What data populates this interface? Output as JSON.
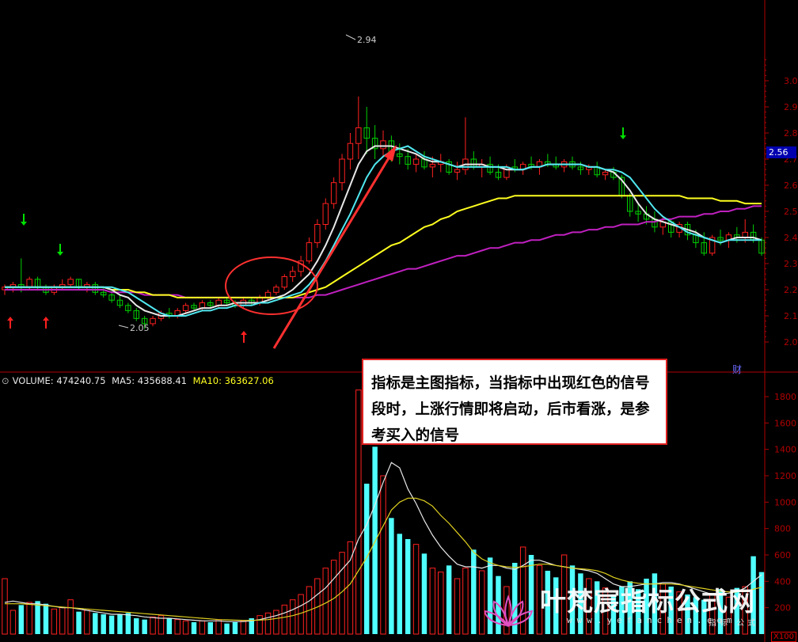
{
  "chart_data": [
    {
      "type": "candlestick",
      "title": "",
      "price_axis": {
        "ylim": [
          1.93,
          3.05
        ],
        "ticks": [
          2.0,
          2.1,
          2.2,
          2.3,
          2.4,
          2.5,
          2.6,
          2.7,
          2.8,
          2.9,
          3.0
        ]
      },
      "current_price": "2.56",
      "high_label": "2.94",
      "low_label": "2.05",
      "candles": [
        [
          2.2,
          2.22,
          2.18,
          2.21
        ],
        [
          2.21,
          2.23,
          2.19,
          2.22
        ],
        [
          2.22,
          2.32,
          2.19,
          2.21
        ],
        [
          2.21,
          2.25,
          2.2,
          2.24
        ],
        [
          2.24,
          2.25,
          2.2,
          2.21
        ],
        [
          2.21,
          2.22,
          2.18,
          2.19
        ],
        [
          2.19,
          2.22,
          2.18,
          2.21
        ],
        [
          2.21,
          2.24,
          2.2,
          2.22
        ],
        [
          2.22,
          2.25,
          2.21,
          2.24
        ],
        [
          2.24,
          2.24,
          2.2,
          2.21
        ],
        [
          2.21,
          2.23,
          2.19,
          2.22
        ],
        [
          2.22,
          2.23,
          2.18,
          2.19
        ],
        [
          2.19,
          2.21,
          2.17,
          2.18
        ],
        [
          2.18,
          2.2,
          2.15,
          2.16
        ],
        [
          2.16,
          2.18,
          2.13,
          2.14
        ],
        [
          2.14,
          2.15,
          2.11,
          2.12
        ],
        [
          2.12,
          2.13,
          2.08,
          2.09
        ],
        [
          2.09,
          2.1,
          2.05,
          2.07
        ],
        [
          2.07,
          2.1,
          2.06,
          2.09
        ],
        [
          2.09,
          2.12,
          2.08,
          2.11
        ],
        [
          2.11,
          2.13,
          2.09,
          2.1
        ],
        [
          2.1,
          2.13,
          2.09,
          2.12
        ],
        [
          2.12,
          2.15,
          2.11,
          2.14
        ],
        [
          2.14,
          2.15,
          2.12,
          2.13
        ],
        [
          2.13,
          2.16,
          2.12,
          2.15
        ],
        [
          2.15,
          2.16,
          2.13,
          2.14
        ],
        [
          2.14,
          2.17,
          2.13,
          2.16
        ],
        [
          2.16,
          2.17,
          2.14,
          2.15
        ],
        [
          2.15,
          2.16,
          2.13,
          2.14
        ],
        [
          2.14,
          2.17,
          2.13,
          2.16
        ],
        [
          2.16,
          2.17,
          2.14,
          2.15
        ],
        [
          2.15,
          2.18,
          2.14,
          2.17
        ],
        [
          2.17,
          2.2,
          2.16,
          2.19
        ],
        [
          2.19,
          2.22,
          2.18,
          2.21
        ],
        [
          2.21,
          2.26,
          2.2,
          2.25
        ],
        [
          2.25,
          2.29,
          2.23,
          2.27
        ],
        [
          2.27,
          2.33,
          2.25,
          2.31
        ],
        [
          2.31,
          2.4,
          2.3,
          2.38
        ],
        [
          2.38,
          2.47,
          2.36,
          2.45
        ],
        [
          2.45,
          2.55,
          2.43,
          2.53
        ],
        [
          2.53,
          2.63,
          2.51,
          2.61
        ],
        [
          2.61,
          2.72,
          2.58,
          2.7
        ],
        [
          2.7,
          2.8,
          2.66,
          2.76
        ],
        [
          2.76,
          2.94,
          2.7,
          2.82
        ],
        [
          2.82,
          2.9,
          2.72,
          2.78
        ],
        [
          2.78,
          2.83,
          2.7,
          2.74
        ],
        [
          2.74,
          2.81,
          2.71,
          2.77
        ],
        [
          2.77,
          2.79,
          2.69,
          2.72
        ],
        [
          2.72,
          2.76,
          2.68,
          2.71
        ],
        [
          2.71,
          2.74,
          2.66,
          2.68
        ],
        [
          2.68,
          2.72,
          2.65,
          2.7
        ],
        [
          2.7,
          2.73,
          2.66,
          2.67
        ],
        [
          2.67,
          2.71,
          2.63,
          2.68
        ],
        [
          2.68,
          2.72,
          2.65,
          2.69
        ],
        [
          2.69,
          2.7,
          2.64,
          2.65
        ],
        [
          2.65,
          2.69,
          2.62,
          2.66
        ],
        [
          2.66,
          2.86,
          2.64,
          2.7
        ],
        [
          2.7,
          2.73,
          2.66,
          2.67
        ],
        [
          2.67,
          2.7,
          2.63,
          2.68
        ],
        [
          2.68,
          2.71,
          2.64,
          2.65
        ],
        [
          2.65,
          2.68,
          2.62,
          2.63
        ],
        [
          2.63,
          2.68,
          2.62,
          2.67
        ],
        [
          2.67,
          2.7,
          2.65,
          2.66
        ],
        [
          2.66,
          2.69,
          2.64,
          2.68
        ],
        [
          2.68,
          2.71,
          2.66,
          2.67
        ],
        [
          2.67,
          2.7,
          2.64,
          2.69
        ],
        [
          2.69,
          2.72,
          2.67,
          2.68
        ],
        [
          2.68,
          2.71,
          2.66,
          2.67
        ],
        [
          2.67,
          2.7,
          2.65,
          2.69
        ],
        [
          2.69,
          2.71,
          2.66,
          2.67
        ],
        [
          2.67,
          2.69,
          2.64,
          2.66
        ],
        [
          2.66,
          2.68,
          2.64,
          2.67
        ],
        [
          2.67,
          2.69,
          2.63,
          2.64
        ],
        [
          2.64,
          2.66,
          2.62,
          2.65
        ],
        [
          2.65,
          2.67,
          2.62,
          2.63
        ],
        [
          2.63,
          2.64,
          2.55,
          2.56
        ],
        [
          2.56,
          2.57,
          2.48,
          2.5
        ],
        [
          2.5,
          2.53,
          2.46,
          2.49
        ],
        [
          2.49,
          2.52,
          2.45,
          2.47
        ],
        [
          2.47,
          2.5,
          2.42,
          2.44
        ],
        [
          2.44,
          2.48,
          2.41,
          2.46
        ],
        [
          2.46,
          2.47,
          2.4,
          2.42
        ],
        [
          2.42,
          2.46,
          2.4,
          2.45
        ],
        [
          2.45,
          2.46,
          2.39,
          2.41
        ],
        [
          2.41,
          2.43,
          2.36,
          2.38
        ],
        [
          2.38,
          2.42,
          2.33,
          2.34
        ],
        [
          2.34,
          2.41,
          2.33,
          2.4
        ],
        [
          2.4,
          2.43,
          2.37,
          2.39
        ],
        [
          2.39,
          2.42,
          2.36,
          2.41
        ],
        [
          2.41,
          2.44,
          2.38,
          2.4
        ],
        [
          2.4,
          2.47,
          2.38,
          2.42
        ],
        [
          2.42,
          2.45,
          2.38,
          2.39
        ],
        [
          2.39,
          2.4,
          2.33,
          2.34
        ]
      ],
      "ma_lines": {
        "white": [
          2.21,
          2.21,
          2.21,
          2.21,
          2.21,
          2.21,
          2.21,
          2.21,
          2.21,
          2.21,
          2.21,
          2.21,
          2.21,
          2.2,
          2.18,
          2.17,
          2.14,
          2.12,
          2.11,
          2.1,
          2.1,
          2.1,
          2.11,
          2.12,
          2.13,
          2.13,
          2.14,
          2.14,
          2.15,
          2.15,
          2.15,
          2.15,
          2.16,
          2.17,
          2.18,
          2.2,
          2.23,
          2.26,
          2.31,
          2.37,
          2.44,
          2.52,
          2.6,
          2.68,
          2.73,
          2.75,
          2.75,
          2.75,
          2.74,
          2.73,
          2.72,
          2.7,
          2.69,
          2.69,
          2.68,
          2.67,
          2.68,
          2.68,
          2.68,
          2.67,
          2.67,
          2.66,
          2.66,
          2.66,
          2.67,
          2.67,
          2.68,
          2.68,
          2.68,
          2.68,
          2.68,
          2.67,
          2.67,
          2.66,
          2.65,
          2.62,
          2.58,
          2.53,
          2.49,
          2.47,
          2.46,
          2.45,
          2.44,
          2.43,
          2.42,
          2.4,
          2.39,
          2.38,
          2.39,
          2.4,
          2.4,
          2.4,
          2.39
        ],
        "cyan": [
          2.21,
          2.21,
          2.21,
          2.21,
          2.21,
          2.21,
          2.21,
          2.21,
          2.21,
          2.21,
          2.21,
          2.21,
          2.21,
          2.21,
          2.2,
          2.19,
          2.17,
          2.15,
          2.13,
          2.11,
          2.1,
          2.1,
          2.1,
          2.11,
          2.12,
          2.12,
          2.13,
          2.13,
          2.14,
          2.14,
          2.14,
          2.15,
          2.15,
          2.16,
          2.17,
          2.18,
          2.19,
          2.22,
          2.26,
          2.31,
          2.37,
          2.43,
          2.49,
          2.56,
          2.63,
          2.68,
          2.71,
          2.73,
          2.74,
          2.75,
          2.73,
          2.71,
          2.7,
          2.69,
          2.68,
          2.67,
          2.67,
          2.67,
          2.67,
          2.67,
          2.67,
          2.67,
          2.66,
          2.66,
          2.67,
          2.67,
          2.68,
          2.68,
          2.68,
          2.68,
          2.68,
          2.67,
          2.67,
          2.66,
          2.66,
          2.65,
          2.63,
          2.59,
          2.55,
          2.51,
          2.48,
          2.46,
          2.44,
          2.42,
          2.41,
          2.4,
          2.39,
          2.38,
          2.39,
          2.39,
          2.39,
          2.39,
          2.39
        ],
        "yellow": [
          2.21,
          2.21,
          2.21,
          2.21,
          2.21,
          2.21,
          2.21,
          2.21,
          2.21,
          2.21,
          2.21,
          2.21,
          2.21,
          2.2,
          2.2,
          2.2,
          2.19,
          2.19,
          2.18,
          2.18,
          2.18,
          2.17,
          2.17,
          2.17,
          2.17,
          2.17,
          2.17,
          2.17,
          2.17,
          2.17,
          2.17,
          2.17,
          2.17,
          2.17,
          2.17,
          2.17,
          2.18,
          2.19,
          2.2,
          2.21,
          2.23,
          2.25,
          2.27,
          2.29,
          2.31,
          2.33,
          2.35,
          2.37,
          2.38,
          2.4,
          2.42,
          2.44,
          2.45,
          2.47,
          2.48,
          2.5,
          2.51,
          2.52,
          2.53,
          2.54,
          2.55,
          2.55,
          2.56,
          2.56,
          2.56,
          2.56,
          2.56,
          2.56,
          2.56,
          2.56,
          2.56,
          2.56,
          2.56,
          2.56,
          2.56,
          2.56,
          2.56,
          2.56,
          2.56,
          2.56,
          2.56,
          2.56,
          2.56,
          2.55,
          2.55,
          2.55,
          2.55,
          2.54,
          2.54,
          2.54,
          2.53,
          2.53,
          2.53
        ],
        "magenta": [
          2.2,
          2.2,
          2.2,
          2.2,
          2.2,
          2.2,
          2.2,
          2.2,
          2.2,
          2.2,
          2.2,
          2.2,
          2.2,
          2.19,
          2.19,
          2.19,
          2.19,
          2.18,
          2.18,
          2.18,
          2.18,
          2.18,
          2.17,
          2.17,
          2.17,
          2.17,
          2.17,
          2.17,
          2.17,
          2.17,
          2.17,
          2.17,
          2.17,
          2.17,
          2.17,
          2.17,
          2.17,
          2.17,
          2.18,
          2.18,
          2.19,
          2.2,
          2.21,
          2.22,
          2.23,
          2.24,
          2.25,
          2.26,
          2.27,
          2.28,
          2.28,
          2.29,
          2.3,
          2.31,
          2.32,
          2.33,
          2.33,
          2.34,
          2.35,
          2.36,
          2.36,
          2.37,
          2.38,
          2.38,
          2.39,
          2.39,
          2.4,
          2.41,
          2.41,
          2.42,
          2.42,
          2.43,
          2.43,
          2.44,
          2.44,
          2.45,
          2.45,
          2.45,
          2.46,
          2.46,
          2.47,
          2.47,
          2.48,
          2.48,
          2.48,
          2.49,
          2.49,
          2.5,
          2.5,
          2.51,
          2.51,
          2.52,
          2.52
        ]
      },
      "buy_arrows": [
        3,
        16,
        88
      ],
      "sell_arrows": [
        9,
        22,
        225
      ],
      "annotations": [
        "ellipse around MA crossover",
        "red up arrow"
      ]
    },
    {
      "type": "bar",
      "title": "VOLUME",
      "ylim": [
        0,
        1900
      ],
      "ticks": [
        200,
        400,
        600,
        800,
        1000,
        1200,
        1400,
        1600,
        1800
      ],
      "values": [
        420,
        180,
        220,
        240,
        250,
        230,
        190,
        200,
        260,
        170,
        180,
        160,
        150,
        140,
        150,
        160,
        120,
        110,
        130,
        140,
        120,
        110,
        100,
        90,
        100,
        90,
        110,
        80,
        90,
        100,
        120,
        140,
        160,
        180,
        220,
        260,
        300,
        360,
        420,
        500,
        560,
        620,
        700,
        1850,
        1140,
        1420,
        1200,
        880,
        760,
        720,
        680,
        610,
        500,
        470,
        520,
        420,
        500,
        640,
        480,
        580,
        440,
        360,
        540,
        660,
        600,
        520,
        480,
        430,
        600,
        520,
        460,
        420,
        400,
        350,
        300,
        360,
        400,
        340,
        420,
        460,
        380,
        360,
        320,
        300,
        280,
        260,
        300,
        340,
        280,
        350,
        360,
        590,
        470
      ],
      "ma5": [
        240,
        250,
        240,
        230,
        230,
        220,
        210,
        200,
        200,
        190,
        180,
        170,
        160,
        150,
        150,
        145,
        140,
        130,
        125,
        120,
        120,
        115,
        110,
        105,
        100,
        100,
        100,
        95,
        95,
        95,
        100,
        110,
        125,
        140,
        160,
        185,
        215,
        250,
        300,
        350,
        420,
        490,
        560,
        720,
        830,
        980,
        1150,
        1300,
        1260,
        1100,
        990,
        860,
        750,
        660,
        590,
        530,
        510,
        510,
        500,
        520,
        520,
        500,
        490,
        520,
        560,
        560,
        540,
        520,
        510,
        500,
        490,
        480,
        460,
        420,
        380,
        360,
        360,
        370,
        380,
        380,
        390,
        390,
        380,
        360,
        340,
        320,
        300,
        300,
        310,
        320,
        350,
        400,
        450
      ],
      "ma10": [
        230,
        230,
        230,
        225,
        220,
        215,
        210,
        205,
        200,
        195,
        190,
        185,
        180,
        175,
        170,
        165,
        160,
        155,
        150,
        145,
        140,
        135,
        130,
        125,
        120,
        115,
        110,
        108,
        106,
        104,
        104,
        106,
        110,
        118,
        128,
        140,
        158,
        180,
        205,
        235,
        270,
        320,
        380,
        480,
        580,
        700,
        820,
        940,
        1000,
        1030,
        1030,
        1010,
        970,
        900,
        840,
        770,
        700,
        620,
        570,
        540,
        520,
        510,
        505,
        510,
        520,
        530,
        530,
        520,
        510,
        500,
        495,
        490,
        480,
        460,
        430,
        410,
        395,
        385,
        380,
        380,
        380,
        380,
        375,
        365,
        355,
        345,
        335,
        325,
        320,
        320,
        325,
        340,
        355
      ]
    }
  ],
  "volume_header": {
    "volume_label": "VOLUME: 474240.75",
    "ma5_label": "MA5: 435688.41",
    "ma10_label": "MA10: 363627.06"
  },
  "annotation_text": "指标是主图指标，当指标中出现红色的信号段时，上涨行情即将启动，后市看涨，是参考买入的信号",
  "tab_label": "财",
  "unit_label": "X100",
  "watermark": {
    "title": "叶梵宸指标公式网",
    "url": "www.yefanchen.com",
    "sub": "指标 公式"
  },
  "colors": {
    "up": "#ff2020",
    "down": "#00d000",
    "volume_up": "#ff2020",
    "volume_down": "#50ffff",
    "ma_white": "#e8e8e8",
    "ma_cyan": "#50e8f0",
    "ma_yellow": "#ffff20",
    "ma_magenta": "#c020c0",
    "axis": "#b00000"
  }
}
